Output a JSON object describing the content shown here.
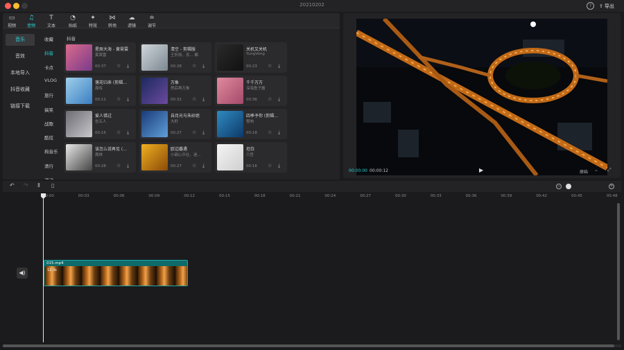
{
  "window": {
    "title": "20210202",
    "export_label": "导出",
    "export_icon": "export-icon",
    "help_icon": "help-icon"
  },
  "colors": {
    "accent": "#2fd3d8",
    "clip": "#0f6a6a"
  },
  "toolbar": [
    {
      "label": "视频",
      "icon": "video-icon",
      "glyph": "▭"
    },
    {
      "label": "音频",
      "icon": "audio-icon",
      "glyph": "♫"
    },
    {
      "label": "文本",
      "icon": "text-icon",
      "glyph": "T"
    },
    {
      "label": "贴纸",
      "icon": "sticker-icon",
      "glyph": "◔"
    },
    {
      "label": "特效",
      "icon": "effects-icon",
      "glyph": "✦"
    },
    {
      "label": "转场",
      "icon": "transition-icon",
      "glyph": "⋈"
    },
    {
      "label": "滤镜",
      "icon": "filter-icon",
      "glyph": "☁"
    },
    {
      "label": "调节",
      "icon": "adjust-icon",
      "glyph": "≐"
    }
  ],
  "categories": [
    "音乐",
    "音效",
    "本地导入",
    "抖音收藏",
    "链接下载"
  ],
  "subcategories": [
    "收藏",
    "抖音",
    "卡点",
    "VLOG",
    "旅行",
    "搞笑",
    "战歌",
    "酷炫",
    "拘音乐",
    "清行",
    "运动"
  ],
  "section_title": "抖音",
  "songs": [
    {
      "title": "星辰大海 - 黄霄雲",
      "artist": "黄霄雲",
      "duration": "00:37",
      "thumb": "linear-gradient(135deg,#d96b8c,#7a3a8a)"
    },
    {
      "title": "清空 - 剪辑版",
      "artist": "王忻辰、苏... 都",
      "duration": "00:28",
      "thumb": "linear-gradient(135deg,#cfd6dc,#7d8790)"
    },
    {
      "title": "关机又关机",
      "artist": "YungVong",
      "duration": "00:23",
      "thumb": "linear-gradient(135deg,#2a2a2a,#111)"
    },
    {
      "title": "落花归来 (剪辑...",
      "artist": "周晖",
      "duration": "00:11",
      "thumb": "linear-gradient(135deg,#9fd0ec,#3a7ec0)"
    },
    {
      "title": "万象",
      "artist": "然后再万象",
      "duration": "00:32",
      "thumb": "linear-gradient(135deg,#1c2a5e,#6c4aa0)"
    },
    {
      "title": "千千万万",
      "artist": "深海鱼子酱",
      "duration": "00:36",
      "thumb": "linear-gradient(135deg,#e08a9e,#a44a6a)"
    },
    {
      "title": "爱人错过",
      "artist": "告五人",
      "duration": "00:16",
      "thumb": "linear-gradient(135deg,#6c6c72,#c7c7cc)"
    },
    {
      "title": "自月光与朱砂痣",
      "artist": "大籽",
      "duration": "00:27",
      "thumb": "linear-gradient(135deg,#1a3a7a,#5fa0d8)"
    },
    {
      "title": "四季予你 (剪辑...",
      "artist": "程响",
      "duration": "00:18",
      "thumb": "linear-gradient(135deg,#2f8ac0,#0e3a6a)"
    },
    {
      "title": "该怎么说再见 (...",
      "artist": "周林",
      "duration": "00:28",
      "thumb": "linear-gradient(135deg,#e8e8e8,#444)"
    },
    {
      "title": "欧边暮遇",
      "artist": "小甜心乐社、迷...",
      "duration": "00:27",
      "thumb": "linear-gradient(135deg,#f0b020,#8a4a08)"
    },
    {
      "title": "坦白",
      "artist": "六哲",
      "duration": "00:16",
      "thumb": "linear-gradient(135deg,#f4f4f4,#cfcfcf)"
    }
  ],
  "player": {
    "current_time": "00:00:00",
    "total_time": "00:00:12",
    "ratio_label": "原始"
  },
  "timeline": {
    "ticks": [
      "00:00",
      "00:03",
      "00:06",
      "00:09",
      "00:12",
      "00:15",
      "00:18",
      "00:21",
      "00:24",
      "00:27",
      "00:30",
      "00:33",
      "00:36",
      "00:39",
      "00:42",
      "00:45",
      "00:48"
    ],
    "clip_name": "015.mp4",
    "clip_duration": "12.3s"
  }
}
